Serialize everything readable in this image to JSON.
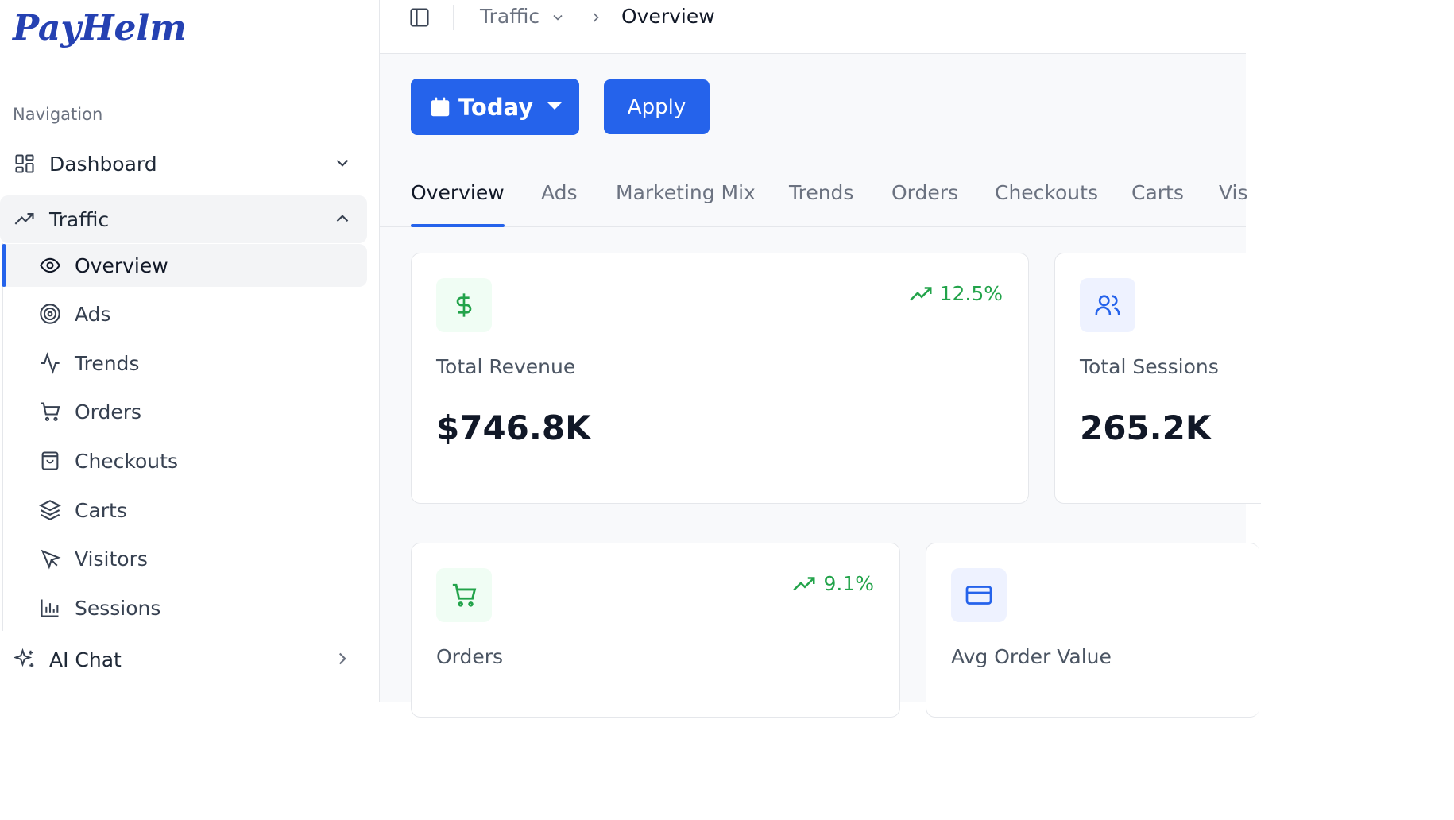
{
  "brand": {
    "logo": "PayHelm"
  },
  "sidebar": {
    "heading": "Navigation",
    "dashboard": "Dashboard",
    "traffic": "Traffic",
    "sub_items": [
      "Overview",
      "Ads",
      "Trends",
      "Orders",
      "Checkouts",
      "Carts",
      "Visitors",
      "Sessions"
    ],
    "ai_chat": "AI Chat"
  },
  "breadcrumb": {
    "parent": "Traffic",
    "current": "Overview"
  },
  "toolbar": {
    "date_label": "Today",
    "apply_label": "Apply"
  },
  "tabs": [
    "Overview",
    "Ads",
    "Marketing Mix",
    "Trends",
    "Orders",
    "Checkouts",
    "Carts",
    "Vis"
  ],
  "cards": {
    "revenue": {
      "label": "Total Revenue",
      "value": "$746.8K",
      "trend": "12.5%"
    },
    "sessions": {
      "label": "Total Sessions",
      "value": "265.2K"
    },
    "orders": {
      "label": "Orders",
      "trend": "9.1%"
    },
    "aov": {
      "label": "Avg Order Value"
    }
  },
  "colors": {
    "accent": "#2563eb",
    "positive": "#22a34a",
    "brand": "#2541b2"
  }
}
